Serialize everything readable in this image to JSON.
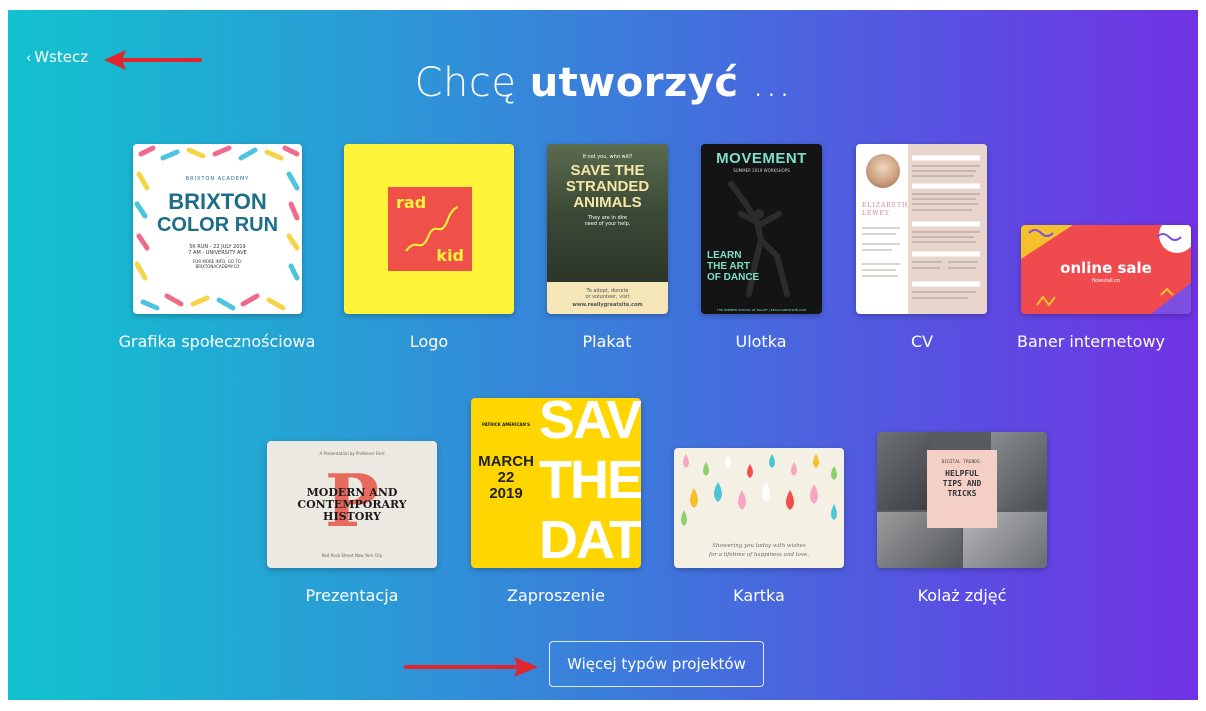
{
  "nav": {
    "back_label": "Wstecz"
  },
  "heading": {
    "light": "Chcę",
    "bold": "utworzyć",
    "ellipsis": "..."
  },
  "cards": [
    {
      "label": "Grafika społecznościowa",
      "thumb": {
        "org": "BRIXTON ACADEMY",
        "line1": "BRIXTON",
        "line2": "COLOR RUN",
        "detail1": "5K RUN - 22 JULY 2019",
        "detail2": "7 AM - UNIVERSITY AVE",
        "detail3": "FOR MORE INFO, GO TO:",
        "detail4": "BRIXTONACADEMY.CO"
      }
    },
    {
      "label": "Logo",
      "thumb": {
        "word1": "rad",
        "word2": "kid"
      }
    },
    {
      "label": "Plakat",
      "thumb": {
        "top": "If not you, who will?",
        "line1": "SAVE THE",
        "line2": "STRANDED",
        "line3": "ANIMALS",
        "sub1": "They are in dire",
        "sub2": "need of your help.",
        "cta1": "To adopt, donate",
        "cta2": "or volunteer, visit",
        "url": "www.reallygreatsite.com"
      }
    },
    {
      "label": "Ulotka",
      "thumb": {
        "title": "MOVEMENT",
        "sub": "SUMMER 2019 WORKSHOPS",
        "l1": "LEARN",
        "l2": "THE ART",
        "l3": "OF DANCE",
        "foot": "THE PREMIER SCHOOL OF BALLET | REALLYGREATSITE.COM"
      }
    },
    {
      "label": "CV",
      "thumb": {
        "name1": "ELIZABETH",
        "name2": "LEWEY"
      }
    },
    {
      "label": "Baner internetowy",
      "thumb": {
        "title": "online sale",
        "sub": "flowstall.co"
      }
    },
    {
      "label": "Prezentacja",
      "thumb": {
        "top": "A Presentation by Professor Ford",
        "l1": "MODERN AND",
        "l2": "CONTEMPORARY",
        "l3": "HISTORY",
        "bottom": "Red Rock Street New York City"
      }
    },
    {
      "label": "Zaproszenie",
      "thumb": {
        "names": "PATRICK AMERICAN'S",
        "l1": "MARCH",
        "l2": "22",
        "l3": "2019",
        "big1": "SAVE",
        "big2": "THE",
        "big3": "DATE"
      }
    },
    {
      "label": "Kartka",
      "thumb": {
        "l1": "Showering you today with wishes",
        "l2": "for a lifetime of happiness and love."
      }
    },
    {
      "label": "Kolaż zdjęć",
      "thumb": {
        "top": "DIGITAL TRENDS:",
        "l1": "HELPFUL",
        "l2": "TIPS AND",
        "l3": "TRICKS"
      }
    }
  ],
  "more_button": {
    "label": "Więcej typów projektów"
  },
  "colors": {
    "gradient_start": "#12c2cf",
    "gradient_end": "#7133e4",
    "annotation_arrow": "#e0252c"
  }
}
